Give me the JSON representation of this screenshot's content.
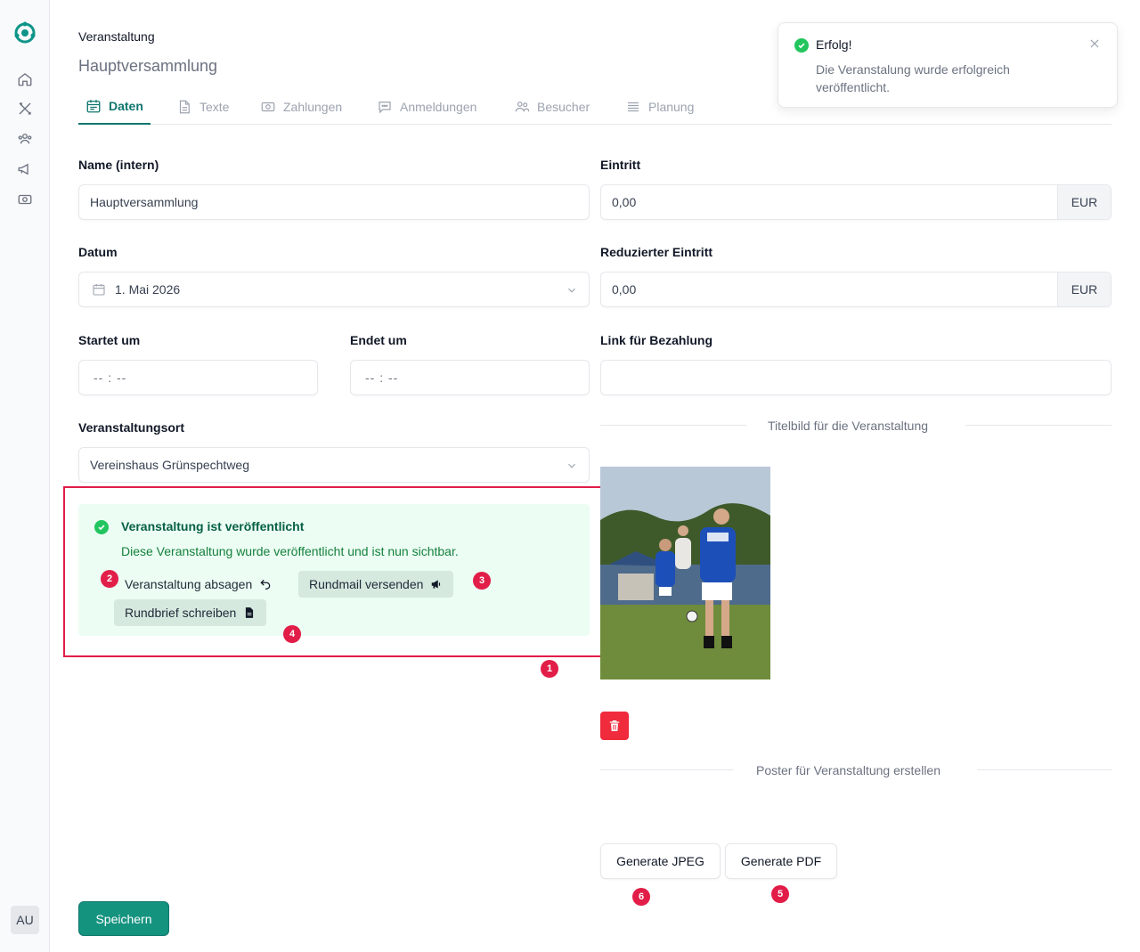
{
  "header": {
    "section": "Veranstaltung",
    "title": "Hauptversammlung"
  },
  "tabs": [
    {
      "label": "Daten",
      "icon": "calendar-icon",
      "active": true
    },
    {
      "label": "Texte",
      "icon": "document-icon",
      "active": false
    },
    {
      "label": "Zahlungen",
      "icon": "banknote-icon",
      "active": false
    },
    {
      "label": "Anmeldungen",
      "icon": "chat-icon",
      "active": false
    },
    {
      "label": "Besucher",
      "icon": "users-icon",
      "active": false
    },
    {
      "label": "Planung",
      "icon": "list-icon",
      "active": false
    }
  ],
  "form": {
    "name_label": "Name (intern)",
    "name_value": "Hauptversammlung",
    "date_label": "Datum",
    "date_value": "1. Mai 2026",
    "start_label": "Startet um",
    "start_value": "-- : --",
    "end_label": "Endet um",
    "end_value": "-- : --",
    "location_label": "Veranstaltungsort",
    "location_value": "Vereinshaus Grünspechtweg",
    "entry_label": "Eintritt",
    "entry_value": "0,00",
    "entry_currency": "EUR",
    "reduced_label": "Reduzierter Eintritt",
    "reduced_value": "0,00",
    "reduced_currency": "EUR",
    "payment_link_label": "Link für Bezahlung",
    "payment_link_value": ""
  },
  "published": {
    "title": "Veranstaltung ist veröffentlicht",
    "description": "Diese Veranstaltung wurde veröffentlicht und ist nun sichtbar.",
    "cancel_label": "Veranstaltung absagen",
    "mail_label": "Rundmail versenden",
    "letter_label": "Rundbrief schreiben"
  },
  "cover": {
    "heading": "Titelbild für die Veranstaltung"
  },
  "poster": {
    "heading": "Poster für Veranstaltung erstellen",
    "jpeg_label": "Generate JPEG",
    "pdf_label": "Generate PDF"
  },
  "save_label": "Speichern",
  "avatar_initials": "AU",
  "toast": {
    "title": "Erfolg!",
    "message": "Die Veranstalung wurde erfolgreich veröffentlicht."
  },
  "badges": {
    "b1": "1",
    "b2": "2",
    "b3": "3",
    "b4": "4",
    "b5": "5",
    "b6": "6"
  },
  "colors": {
    "accent": "#0f766e",
    "success_bg": "#ecfdf3",
    "danger": "#ef2b3c",
    "annotation": "#e11d48"
  }
}
